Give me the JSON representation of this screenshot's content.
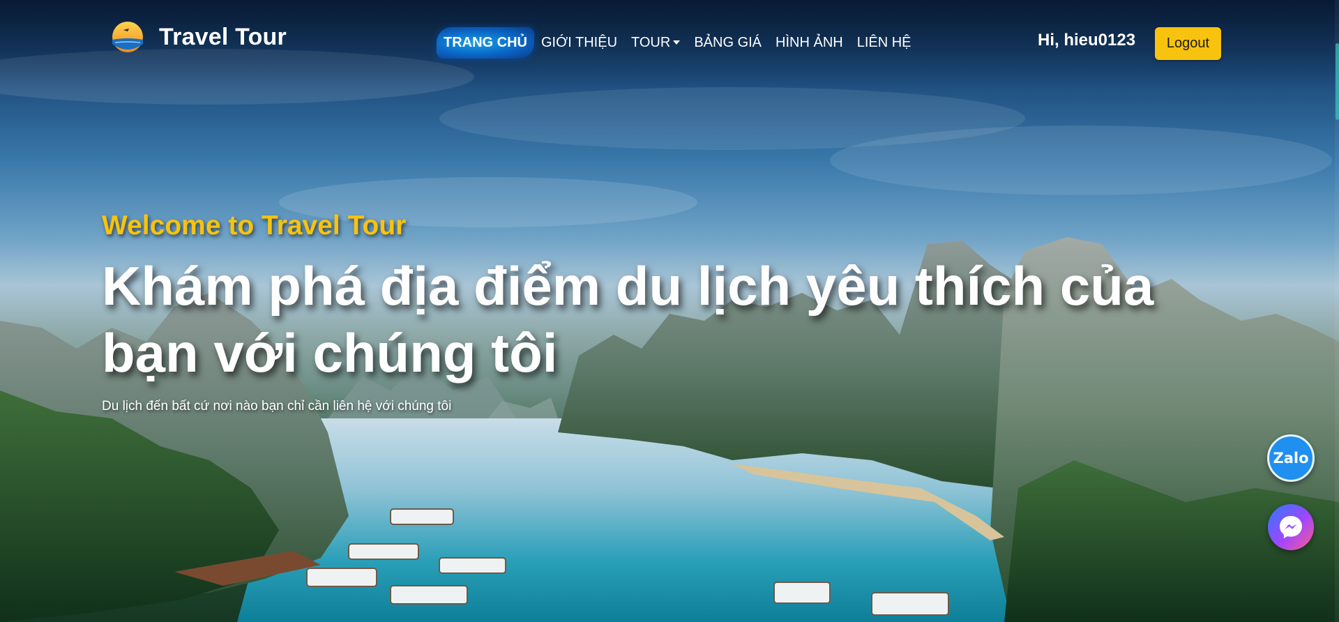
{
  "brand": {
    "name": "Travel Tour",
    "logo_icon": "sunset-sea-logo"
  },
  "nav": {
    "items": [
      {
        "label": "TRANG CHỦ",
        "active": true
      },
      {
        "label": "GIỚI THIỆU"
      },
      {
        "label": "TOUR",
        "has_dropdown": true
      },
      {
        "label": "BẢNG GIÁ"
      },
      {
        "label": "HÌNH ẢNH"
      },
      {
        "label": "LIÊN HỆ"
      }
    ]
  },
  "user": {
    "greeting": "Hi, hieu0123",
    "logout_label": "Logout"
  },
  "hero": {
    "kicker": "Welcome to Travel Tour",
    "headline": "Khám phá địa điểm du lịch yêu thích của bạn với chúng tôi",
    "subtitle": "Du lịch đến bất cứ nơi nào bạn chỉ cần liên hệ với chúng tôi"
  },
  "floating": {
    "zalo_label": "Zalo",
    "messenger_icon": "messenger-icon"
  },
  "colors": {
    "accent": "#f8c30e",
    "nav_active": "#0b64c4",
    "zalo": "#1f8ff0"
  }
}
